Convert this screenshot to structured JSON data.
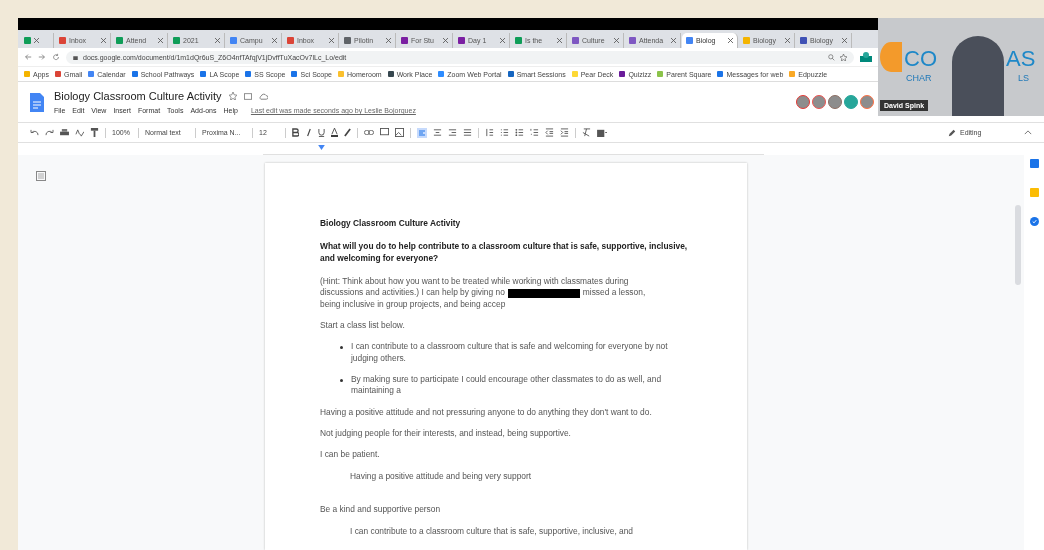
{
  "browser": {
    "tabs": [
      {
        "color": "#0f9d58",
        "selected": false
      },
      {
        "label": "Inbox",
        "color": "#db4437",
        "selected": false
      },
      {
        "label": "Attend",
        "color": "#0f9d58",
        "selected": false
      },
      {
        "label": "2021",
        "color": "#0f9d58",
        "selected": false
      },
      {
        "label": "Campu",
        "color": "#4285f4",
        "selected": false
      },
      {
        "label": "Inbox",
        "color": "#db4437",
        "selected": false
      },
      {
        "label": "Pilotin",
        "color": "#5f6368",
        "selected": false
      },
      {
        "label": "For Stu",
        "color": "#7b1fa2",
        "selected": false
      },
      {
        "label": "Day 1",
        "color": "#7b1fa2",
        "selected": false
      },
      {
        "label": "Is the",
        "color": "#0f9d58",
        "selected": false
      },
      {
        "label": "Culture",
        "color": "#7e57c2",
        "selected": false
      },
      {
        "label": "Attenda",
        "color": "#7e57c2",
        "selected": false
      },
      {
        "label": "Biolog",
        "color": "#4285f4",
        "selected": true
      },
      {
        "label": "Biology",
        "color": "#f4b400",
        "selected": false
      },
      {
        "label": "Biology",
        "color": "#3f51b5",
        "selected": false
      }
    ],
    "url": "docs.google.com/document/d/1m1dQr6uS_Z6O4nfTAfqjV1jDvffTuXacOv7lLc_Lo/edit",
    "bookmarks": [
      {
        "label": "Apps",
        "color": "#f4b400"
      },
      {
        "label": "Gmail",
        "color": "#db4437"
      },
      {
        "label": "Calendar",
        "color": "#4285f4"
      },
      {
        "label": "School Pathways",
        "color": "#1a73e8"
      },
      {
        "label": "LA Scope",
        "color": "#1a73e8"
      },
      {
        "label": "SS Scope",
        "color": "#1a73e8"
      },
      {
        "label": "Sci Scope",
        "color": "#1a73e8"
      },
      {
        "label": "Homeroom",
        "color": "#fbc02d"
      },
      {
        "label": "Work Place",
        "color": "#37474f"
      },
      {
        "label": "Zoom Web Portal",
        "color": "#2d8cff"
      },
      {
        "label": "Smart Sessions",
        "color": "#1565c0"
      },
      {
        "label": "Pear Deck",
        "color": "#fdd835"
      },
      {
        "label": "Quizizz",
        "color": "#6a1b9a"
      },
      {
        "label": "Parent Square",
        "color": "#8bc34a"
      },
      {
        "label": "Messages for web",
        "color": "#1a73e8"
      },
      {
        "label": "Edpuzzle",
        "color": "#f9a825"
      }
    ]
  },
  "doc": {
    "title": "Biology Classroom Culture Activity",
    "menus": [
      "File",
      "Edit",
      "View",
      "Insert",
      "Format",
      "Tools",
      "Add-ons",
      "Help"
    ],
    "last_edit": "Last edit was made seconds ago by Leslie Bojorquez",
    "collaborators": [
      {
        "color": "#e53935"
      },
      {
        "color": "#ef5350"
      },
      {
        "color": "#8d6e63"
      },
      {
        "color": "#26a69a"
      },
      {
        "color": "#ff7043"
      }
    ],
    "toolbar": {
      "zoom": "100%",
      "style": "Normal text",
      "font": "Proxima N...",
      "size": "12",
      "mode": "Editing"
    },
    "paragraphs": [
      {
        "kind": "title",
        "text": "Biology Classroom Culture Activity"
      },
      {
        "kind": "question",
        "text": "What will you do to help contribute to a classroom culture that is safe, supportive, inclusive, and welcoming for everyone?"
      },
      {
        "kind": "redacted",
        "first": "(Hint: Think about how you want to be treated while working with classmates during",
        "before": "discussions and activities.) I can help by giving no",
        "after": "missed a lesson,",
        "last": "being inclusive in group projects, and being accep"
      },
      {
        "kind": "text",
        "text": "Start a class list below."
      },
      {
        "kind": "bullet",
        "text": "I can contribute to a classroom culture that is safe and welcoming for everyone by not judging others."
      },
      {
        "kind": "bullet",
        "text": "By making sure to participate I could encourage other classmates to do as well, and maintaining a"
      },
      {
        "kind": "text",
        "text": "Having a positive attitude and not pressuring anyone to do anything they don't want to do."
      },
      {
        "kind": "text",
        "text": "Not judging people for their interests, and instead, being supportive."
      },
      {
        "kind": "text",
        "text": "I can be patient."
      },
      {
        "kind": "indented",
        "text": "Having a positive attitude and being very support"
      },
      {
        "kind": "text",
        "text": "Be a kind and supportive person"
      },
      {
        "kind": "indented",
        "text": "I can contribute to a classroom culture that is safe, supportive, inclusive, and"
      }
    ]
  },
  "video": {
    "name": "David Spink",
    "logo": [
      "CO",
      "AS"
    ],
    "logo_sub": [
      "CHAR",
      "LS"
    ]
  }
}
